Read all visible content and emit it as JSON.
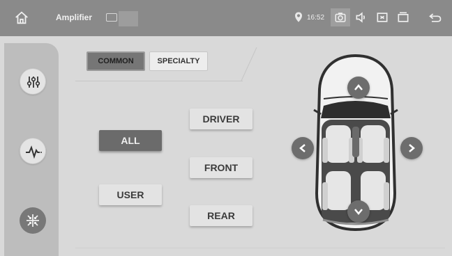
{
  "status_bar": {
    "app_title": "Amplifier",
    "time": "16:52",
    "icons": [
      "home-icon",
      "sd-card-icon",
      "location-icon",
      "camera-icon",
      "volume-icon",
      "screenshot-icon",
      "window-icon",
      "back-icon"
    ]
  },
  "sidebar": {
    "items": [
      {
        "icon": "equalizer-icon",
        "active": false
      },
      {
        "icon": "waveform-icon",
        "active": false
      },
      {
        "icon": "balance-icon",
        "active": true
      }
    ]
  },
  "tabs": [
    {
      "label": "COMMON",
      "selected": true
    },
    {
      "label": "SPECIALTY",
      "selected": false
    }
  ],
  "buttons": {
    "driver": "DRIVER",
    "all": "ALL",
    "front": "FRONT",
    "user": "USER",
    "rear": "REAR"
  },
  "colors": {
    "statusbar": "#8a8a8a",
    "background": "#d9d9d9",
    "selected": "#6b6b6b"
  }
}
